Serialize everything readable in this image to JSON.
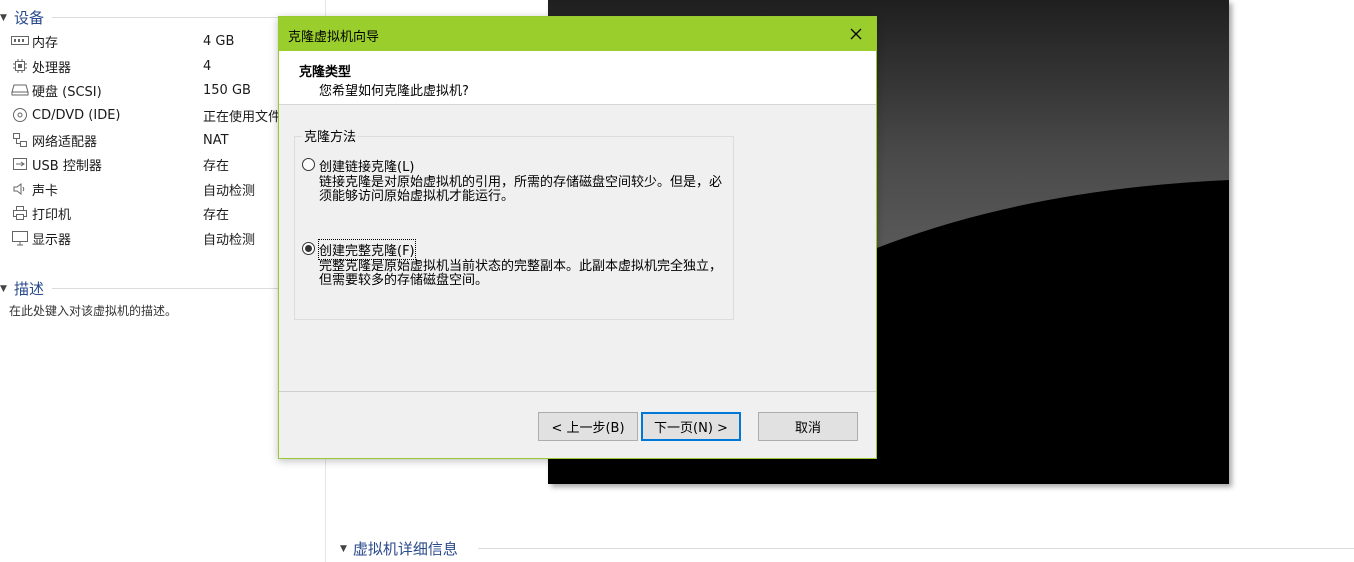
{
  "devices": {
    "header": "设备",
    "items": [
      {
        "icon": "memory-icon",
        "name": "内存",
        "value": "4 GB"
      },
      {
        "icon": "processor-icon",
        "name": "处理器",
        "value": "4"
      },
      {
        "icon": "hard-disk-icon",
        "name": "硬盘 (SCSI)",
        "value": "150 GB"
      },
      {
        "icon": "cd-dvd-icon",
        "name": "CD/DVD (IDE)",
        "value": "正在使用文件"
      },
      {
        "icon": "network-adapter-icon",
        "name": "网络适配器",
        "value": "NAT"
      },
      {
        "icon": "usb-icon",
        "name": "USB 控制器",
        "value": "存在"
      },
      {
        "icon": "sound-icon",
        "name": "声卡",
        "value": "自动检测"
      },
      {
        "icon": "printer-icon",
        "name": "打印机",
        "value": "存在"
      },
      {
        "icon": "display-icon",
        "name": "显示器",
        "value": "自动检测"
      }
    ]
  },
  "description": {
    "header": "描述",
    "placeholder": "在此处键入对该虚拟机的描述。"
  },
  "details": {
    "header": "虚拟机详细信息"
  },
  "dialog": {
    "title": "克隆虚拟机向导",
    "heading": "克隆类型",
    "subheading": "您希望如何克隆此虚拟机?",
    "group_label": "克隆方法",
    "options": [
      {
        "label": "创建链接克隆(L)",
        "desc": "链接克隆是对原始虚拟机的引用，所需的存储磁盘空间较少。但是，必须能够访问原始虚拟机才能运行。",
        "selected": false
      },
      {
        "label": "创建完整克隆(F)",
        "desc": "完整克隆是原始虚拟机当前状态的完整副本。此副本虚拟机完全独立，但需要较多的存储磁盘空间。",
        "selected": true
      }
    ],
    "buttons": {
      "back": "< 上一步(B)",
      "next": "下一页(N) >",
      "cancel": "取消"
    }
  },
  "colors": {
    "titlebar": "#9ace2c",
    "accent": "#2b4a8c",
    "default_button_border": "#0078d7"
  }
}
